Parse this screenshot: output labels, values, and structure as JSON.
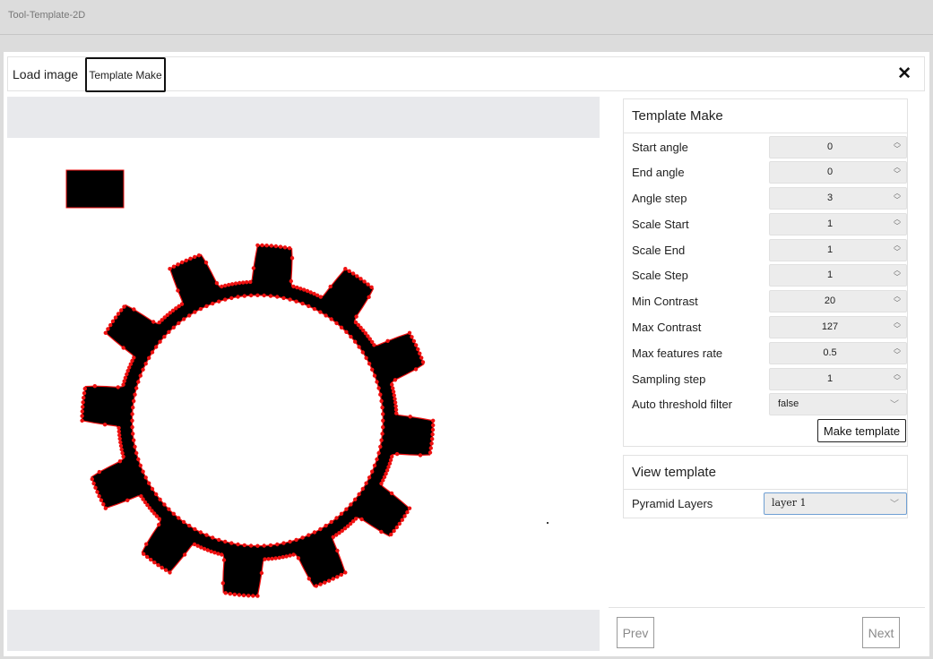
{
  "window": {
    "title": "Tool-Template-2D"
  },
  "tabs": [
    {
      "label": "Load image"
    },
    {
      "label": "Template Make"
    }
  ],
  "template_make": {
    "title": "Template Make",
    "rows": [
      {
        "label": "Start angle",
        "value": "0"
      },
      {
        "label": "End angle",
        "value": "0"
      },
      {
        "label": "Angle step",
        "value": "3"
      },
      {
        "label": "Scale Start",
        "value": "1"
      },
      {
        "label": "Scale End",
        "value": "1"
      },
      {
        "label": "Scale Step",
        "value": "1"
      },
      {
        "label": "Min Contrast",
        "value": "20"
      },
      {
        "label": "Max Contrast",
        "value": "127"
      },
      {
        "label": "Max features rate",
        "value": "0.5"
      },
      {
        "label": "Sampling step",
        "value": "1"
      }
    ],
    "auto_threshold": {
      "label": "Auto threshold filter",
      "value": "false"
    },
    "make_button": "Make template"
  },
  "view_template": {
    "title": "View template",
    "pyramid_label": "Pyramid Layers",
    "pyramid_value": "layer 1"
  },
  "nav": {
    "prev": "Prev",
    "next": "Next"
  },
  "icons": {
    "close": "close-icon",
    "spin": "spin-arrows-icon",
    "dropdown": "chevron-down-icon"
  },
  "colors": {
    "feature_points": "#ee1111",
    "gear": "#000000",
    "input_background": "#ececec",
    "selected_border": "#6f9fd3"
  }
}
